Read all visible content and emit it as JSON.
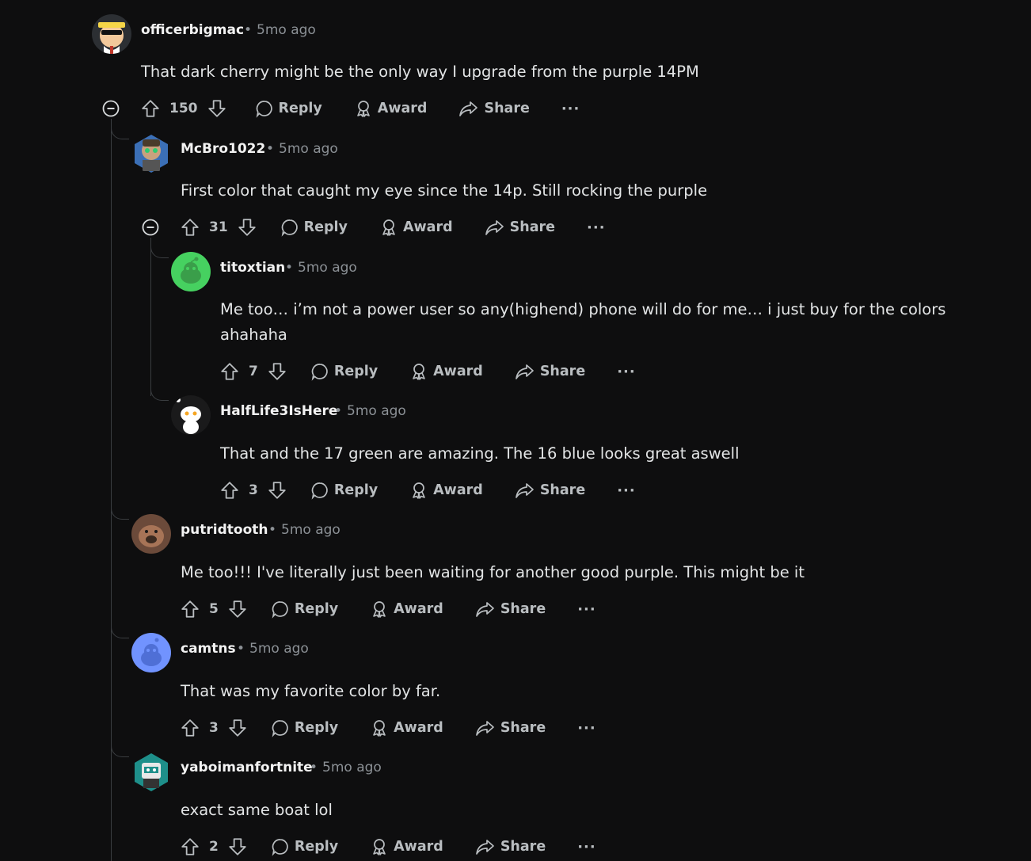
{
  "comments": [
    {
      "user": "officerbigmac",
      "time": "5mo ago",
      "text": "That dark cherry might be the only way I upgrade from the purple 14PM",
      "score": "150",
      "avatar_color": "#2c2f33"
    },
    {
      "user": "McBro1022",
      "time": "5mo ago",
      "text": "First color that caught my eye since the 14p. Still rocking the purple",
      "score": "31",
      "avatar_color": "#3b6fb6"
    },
    {
      "user": "titoxtian",
      "time": "5mo ago",
      "text_line1": "Me too… i’m not a power user so any(highend) phone will do for me… i just buy for the colors",
      "text_line2": "ahahaha",
      "score": "7",
      "avatar_color": "#46d160"
    },
    {
      "user": "HalfLife3IsHere",
      "time": "5mo ago",
      "text": "That and the 17 green are amazing. The 16 blue looks great aswell",
      "score": "3",
      "avatar_color": "#1a1a1b"
    },
    {
      "user": "putridtooth",
      "time": "5mo ago",
      "text": "Me too!!! I've literally just been waiting for another good purple. This might be it",
      "score": "5",
      "avatar_color": "#6b4a3a"
    },
    {
      "user": "camtns",
      "time": "5mo ago",
      "text": "That was my favorite color by far.",
      "score": "3",
      "avatar_color": "#7193ff"
    },
    {
      "user": "yaboimanfortnite",
      "time": "5mo ago",
      "text": "exact same boat lol",
      "score": "2",
      "avatar_color": "#1e8f8a"
    }
  ],
  "actions": {
    "reply": "Reply",
    "award": "Award",
    "share": "Share",
    "more": "···"
  },
  "separator": "•",
  "icons": {
    "upvote": "upvote-arrow-icon",
    "downvote": "downvote-arrow-icon",
    "reply": "speech-bubble-icon",
    "award": "award-ribbon-icon",
    "share": "share-arrow-icon",
    "collapse": "collapse-minus-icon"
  },
  "colors": {
    "background": "#0e0e0f",
    "thread_line": "#3a3d40",
    "action_text": "#b9bdc0",
    "meta_text": "#8c9196"
  }
}
